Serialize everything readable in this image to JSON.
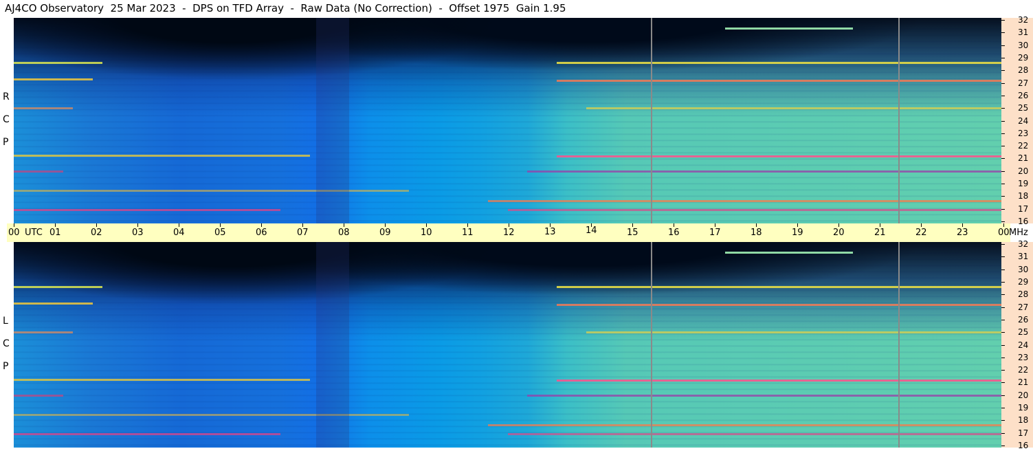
{
  "header": {
    "title": "AJ4CO Observatory  25 Mar 2023  -  DPS on TFD Array  -  Raw Data (No Correction)  -  Offset 1975  Gain 1.95"
  },
  "panels": {
    "rcp": {
      "label": [
        "R",
        "C",
        "P"
      ]
    },
    "lcp": {
      "label": [
        "L",
        "C",
        "P"
      ]
    }
  },
  "time_axis": {
    "labels": [
      "00",
      "01",
      "02",
      "03",
      "04",
      "05",
      "06",
      "07",
      "08",
      "09",
      "10",
      "11",
      "12",
      "13",
      "14",
      "15",
      "16",
      "17",
      "18",
      "19",
      "20",
      "21",
      "22",
      "23",
      "00"
    ],
    "start_extra": "UTC",
    "end_extra": "MHz"
  },
  "freq_axis": {
    "labels": [
      "32",
      "31",
      "30",
      "29",
      "28",
      "27",
      "26",
      "25",
      "24",
      "23",
      "22",
      "21",
      "20",
      "19",
      "18",
      "17",
      "16"
    ]
  },
  "colors": {
    "background": "#ffffff",
    "time_axis_bg": "#ffffc0",
    "freq_axis_bg": "#fde0c8",
    "vertical_marker": "#8a8a8a"
  }
}
